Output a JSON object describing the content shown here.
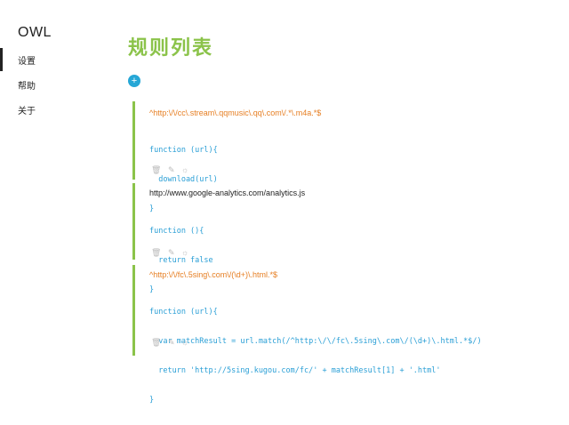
{
  "sidebar": {
    "brand": "OWL",
    "items": [
      {
        "label": "设置"
      },
      {
        "label": "帮助"
      },
      {
        "label": "关于"
      }
    ]
  },
  "main": {
    "title": "规则列表",
    "add_icon": "+",
    "rules": [
      {
        "pattern": "^http:\\/\\/cc\\.stream\\.qqmusic\\.qq\\.com\\/.*\\.m4a.*$",
        "code": [
          "function (url){",
          "  download(url)",
          "}"
        ]
      },
      {
        "pattern": "http://www.google-analytics.com/analytics.js",
        "code": [
          "function (){",
          "  return false",
          "}"
        ]
      },
      {
        "pattern": "^http:\\/\\/fc\\.5sing\\.com\\/(\\d+)\\.html.*$",
        "code": [
          "function (url){",
          "  var matchResult = url.match(/^http:\\/\\/fc\\.5sing\\.com\\/(\\d+)\\.html.*$/)",
          "  return 'http://5sing.kugou.com/fc/' + matchResult[1] + '.html'",
          "}"
        ]
      }
    ],
    "action_icons": {
      "delete": "🗑",
      "edit": "✎",
      "settings": "☼"
    }
  }
}
